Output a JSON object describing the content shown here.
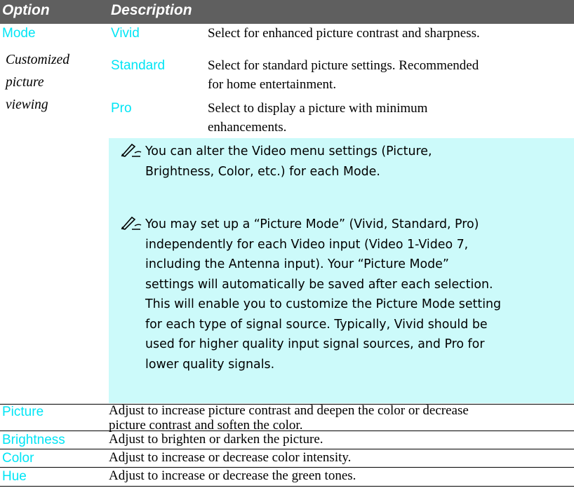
{
  "header": {
    "col1": "Option",
    "col2": "Description"
  },
  "mode": {
    "label": "Mode",
    "subtitle_lines": [
      "Customized",
      "picture",
      "viewing"
    ],
    "options": [
      {
        "name": "Vivid",
        "desc_lines": [
          "Select for enhanced picture contrast and sharpness."
        ]
      },
      {
        "name": "Standard",
        "desc_lines": [
          "Select for standard picture settings. Recommended",
          "for home entertainment."
        ]
      },
      {
        "name": "Pro",
        "desc_lines": [
          "Select to display a picture with minimum",
          "enhancements."
        ]
      }
    ],
    "notes": [
      {
        "icon": "note-pencil-icon",
        "lines": [
          "You can alter the Video menu settings (Picture,",
          "Brightness, Color, etc.) for each Mode."
        ]
      },
      {
        "icon": "note-pencil-icon",
        "lines": [
          "You may set up a “Picture Mode” (Vivid, Standard, Pro)",
          "independently for each Video input (Video 1-Video 7,",
          "including the Antenna input).  Your “Picture Mode”",
          "settings will automatically be saved after each selection.",
          "This will enable you to customize the Picture Mode setting",
          "for each type of signal source.   Typically, Vivid should be",
          "used for higher quality input signal sources, and Pro for",
          "lower quality signals."
        ]
      }
    ]
  },
  "rows": [
    {
      "label": "Picture",
      "desc_lines": [
        "Adjust to increase picture contrast and deepen the color or decrease",
        "picture contrast and soften the color."
      ]
    },
    {
      "label": "Brightness",
      "desc_lines": [
        "Adjust to brighten or darken the picture."
      ]
    },
    {
      "label": "Color",
      "desc_lines": [
        "Adjust to increase or decrease color intensity."
      ]
    },
    {
      "label": "Hue",
      "desc_lines": [
        "Adjust to increase or decrease the green tones."
      ]
    }
  ],
  "colors": {
    "header_bg": "#5f5f5f",
    "accent": "#00e5f5",
    "note_bg": "#ccfafa"
  }
}
